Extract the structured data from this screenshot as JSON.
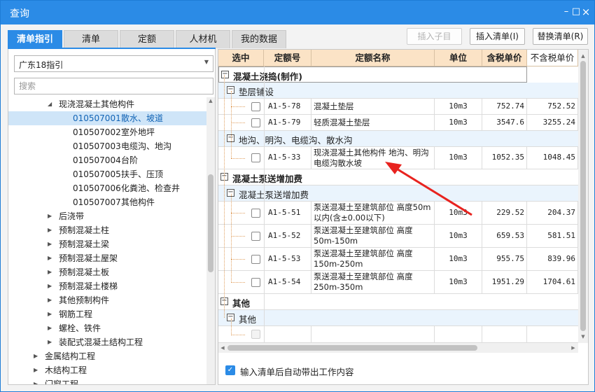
{
  "window": {
    "title": "查询"
  },
  "tabs": [
    "清单指引",
    "清单",
    "定额",
    "人材机",
    "我的数据"
  ],
  "toolbar": {
    "insert_sub": "插入子目",
    "insert_list": "插入清单(I)",
    "replace_list": "替换清单(R)"
  },
  "left": {
    "select_value": "广东18指引",
    "search_placeholder": "搜索",
    "tree": [
      {
        "label": "现浇混凝土其他构件",
        "expanded": true
      },
      {
        "code": "010507001",
        "label": "散水、坡道",
        "selected": true
      },
      {
        "code": "010507002",
        "label": "室外地坪"
      },
      {
        "code": "010507003",
        "label": "电缆沟、地沟"
      },
      {
        "code": "010507004",
        "label": "台阶"
      },
      {
        "code": "010507005",
        "label": "扶手、压顶"
      },
      {
        "code": "010507006",
        "label": "化粪池、检查井"
      },
      {
        "code": "010507007",
        "label": "其他构件"
      },
      {
        "label": "后浇带"
      },
      {
        "label": "预制混凝土柱"
      },
      {
        "label": "预制混凝土梁"
      },
      {
        "label": "预制混凝土屋架"
      },
      {
        "label": "预制混凝土板"
      },
      {
        "label": "预制混凝土楼梯"
      },
      {
        "label": "其他预制构件"
      },
      {
        "label": "钢筋工程"
      },
      {
        "label": "螺栓、铁件"
      },
      {
        "label": "装配式混凝土结构工程"
      },
      {
        "label": "金属结构工程"
      },
      {
        "label": "木结构工程"
      },
      {
        "label": "门窗工程"
      }
    ]
  },
  "grid": {
    "headers": [
      "选中",
      "定额号",
      "定额名称",
      "单位",
      "含税单价",
      "不含税单价"
    ],
    "groups": [
      {
        "label": "混凝土浇捣(制作)"
      },
      {
        "label": "垫层铺设"
      },
      {
        "code": "A1-5-78",
        "name": "混凝土垫层",
        "unit": "10m3",
        "tax": "752.74",
        "notax": "752.52"
      },
      {
        "code": "A1-5-79",
        "name": "轻质混凝土垫层",
        "unit": "10m3",
        "tax": "3547.6",
        "notax": "3255.24"
      },
      {
        "label": "地沟、明沟、电缆沟、散水沟"
      },
      {
        "code": "A1-5-33",
        "name": "现浇混凝土其他构件 地沟、明沟电缆沟散水坡",
        "unit": "10m3",
        "tax": "1052.35",
        "notax": "1048.45"
      },
      {
        "label": "混凝土泵送增加费"
      },
      {
        "label": "混凝土泵送增加费"
      },
      {
        "code": "A1-5-51",
        "name": "泵送混凝土至建筑部位 高度50m以内(含±0.00以下)",
        "unit": "10m3",
        "tax": "229.52",
        "notax": "204.37"
      },
      {
        "code": "A1-5-52",
        "name": "泵送混凝土至建筑部位 高度50m-150m",
        "unit": "10m3",
        "tax": "659.53",
        "notax": "581.51"
      },
      {
        "code": "A1-5-53",
        "name": "泵送混凝土至建筑部位 高度150m-250m",
        "unit": "10m3",
        "tax": "955.75",
        "notax": "839.96"
      },
      {
        "code": "A1-5-54",
        "name": "泵送混凝土至建筑部位 高度250m-350m",
        "unit": "10m3",
        "tax": "1951.29",
        "notax": "1704.61"
      },
      {
        "label": "其他"
      },
      {
        "label": "其他"
      }
    ]
  },
  "footer": {
    "auto_text": "输入清单后自动带出工作内容"
  },
  "icons": {
    "minimize": "minimize-icon",
    "maximize": "maximize-icon",
    "close": "close-icon"
  },
  "colors": {
    "accent": "#2b8be6",
    "header": "#fbe3c6",
    "arrow": "#e8231f"
  }
}
